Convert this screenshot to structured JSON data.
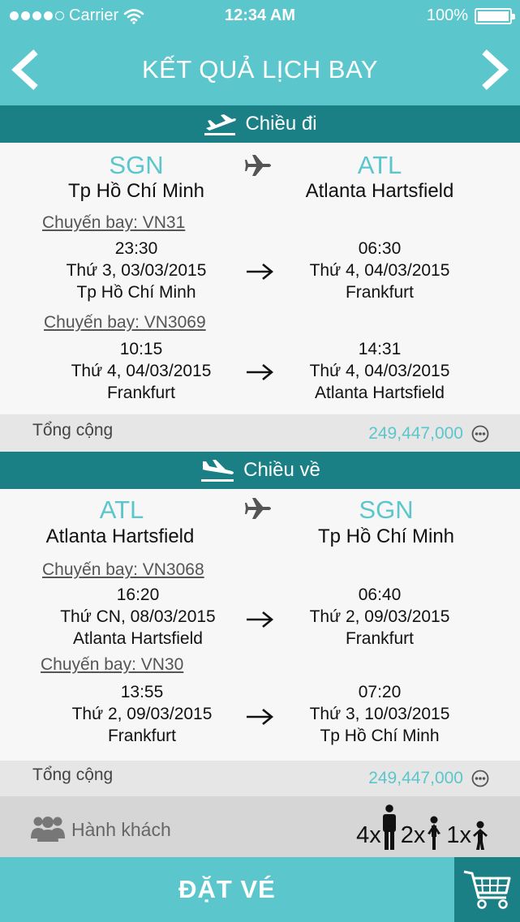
{
  "status": {
    "carrier": "Carrier",
    "time": "12:34 AM",
    "battery": "100%"
  },
  "nav": {
    "title": "KẾT QUẢ LỊCH BAY"
  },
  "outbound": {
    "heading": "Chiều đi",
    "origin_code": "SGN",
    "origin_city": "Tp Hồ Chí Minh",
    "dest_code": "ATL",
    "dest_city": "Atlanta Hartsfield",
    "flights": [
      {
        "label": "Chuyến bay: VN31",
        "dep_time": "23:30",
        "dep_date": "Thứ 3, 03/03/2015",
        "dep_city": "Tp Hồ Chí Minh",
        "arr_time": "06:30",
        "arr_date": "Thứ 4, 04/03/2015",
        "arr_city": "Frankfurt"
      },
      {
        "label": "Chuyến bay: VN3069",
        "dep_time": "10:15",
        "dep_date": "Thứ 4, 04/03/2015",
        "dep_city": "Frankfurt",
        "arr_time": "14:31",
        "arr_date": "Thứ 4, 04/03/2015",
        "arr_city": "Atlanta Hartsfield"
      }
    ],
    "total_label": "Tổng cộng",
    "total_price": "249,447,000"
  },
  "inbound": {
    "heading": "Chiều về",
    "origin_code": "ATL",
    "origin_city": "Atlanta Hartsfield",
    "dest_code": "SGN",
    "dest_city": "Tp Hồ Chí Minh",
    "flights": [
      {
        "label": "Chuyến bay: VN3068",
        "dep_time": "16:20",
        "dep_date": "Thứ CN, 08/03/2015",
        "dep_city": "Atlanta Hartsfield",
        "arr_time": "06:40",
        "arr_date": "Thứ 2, 09/03/2015",
        "arr_city": "Frankfurt"
      },
      {
        "label": "Chuyến bay: VN30",
        "dep_time": "13:55",
        "dep_date": "Thứ 2, 09/03/2015",
        "dep_city": "Frankfurt",
        "arr_time": "07:20",
        "arr_date": "Thứ 3, 10/03/2015",
        "arr_city": "Tp Hồ Chí Minh"
      }
    ],
    "total_label": "Tổng cộng",
    "total_price": "249,447,000"
  },
  "passengers": {
    "label": "Hành khách",
    "adults": "4x",
    "children": "2x",
    "infants": "1x"
  },
  "booking": {
    "button_label": "ĐẶT VÉ"
  },
  "icons": {
    "back": "chevron-left-icon",
    "forward": "chevron-right-icon",
    "takeoff": "plane-takeoff-icon",
    "landing": "plane-landing-icon",
    "plane": "plane-icon",
    "arrow": "arrow-right-icon",
    "more": "more-options-icon",
    "group": "passengers-group-icon",
    "adult": "adult-icon",
    "child": "child-icon",
    "infant": "infant-icon",
    "cart": "cart-icon"
  },
  "colors": {
    "accent": "#5bc6cc",
    "dark": "#1b8086",
    "gray_row": "#e6e6e6",
    "pax_row": "#d6d6d6"
  }
}
